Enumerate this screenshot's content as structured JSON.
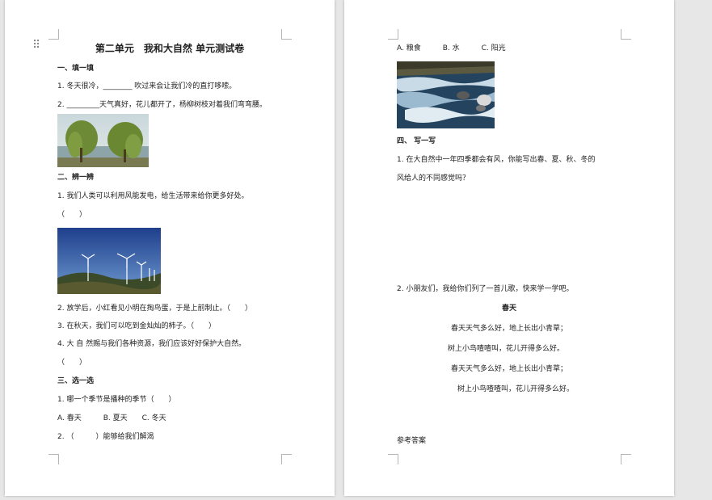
{
  "page1": {
    "title": "第二单元　我和大自然 单元测试卷",
    "sec1_heading": "一、填一填",
    "q1_1": "1. 冬天很冷，________ 吹过来会让我们冷的直打哆嗦。",
    "q1_2": "2. _________天气真好，花儿都开了，杨柳树枝对着我们弯弯腰。",
    "sec2_heading": "二、辨一辨",
    "q2_1": "1. 我们人类可以利用风能发电，给生活带来给你更多好处。",
    "q2_1_paren": "（　　）",
    "q2_2": "2. 放学后，小红看见小明在掏鸟蛋，于是上前制止。（　　）",
    "q2_3": "3. 在秋天，我们可以吃到金灿灿的柿子。（　　）",
    "q2_4": "4. 大 自 然赐与我们各种资源，我们应该好好保护大自然。",
    "q2_4_paren": "（　　）",
    "sec3_heading": "三、选一选",
    "q3_1": "1. 哪一个季节是播种的季节（　　）",
    "q3_1_options": "A. 春天　　　B. 夏天　　C. 冬天",
    "q3_2": "2. （　　　）能够给我们解渴"
  },
  "page2": {
    "options": "A. 粮食　　　B. 水　　　C. 阳光",
    "sec4_heading": "四、 写一写",
    "q4_1_line1": "1. 在大自然中一年四季都会有风，你能写出春、夏、秋、冬的",
    "q4_1_line2": "风给人的不同感觉吗？",
    "q4_2": "2. 小朋友们，我给你们列了一首儿歌，快来学一学吧。",
    "poem_title": "春天",
    "poem_lines": [
      "春天天气多么好，地上长出小青草；",
      "树上小鸟喳喳叫，花儿开得多么好。",
      "春天天气多么好，地上长出小青草；",
      "树上小鸟喳喳叫，花儿开得多么好。"
    ],
    "answer_heading": "参考答案"
  },
  "icons": {
    "drag_handle": "drag-handle-icon",
    "willow_image": "willow-tree-photo",
    "wind_turbine_image": "wind-turbine-photo",
    "river_image": "river-rapids-photo"
  },
  "colors": {
    "canvas": "#e7e7e7",
    "page": "#ffffff",
    "text": "#222222"
  }
}
